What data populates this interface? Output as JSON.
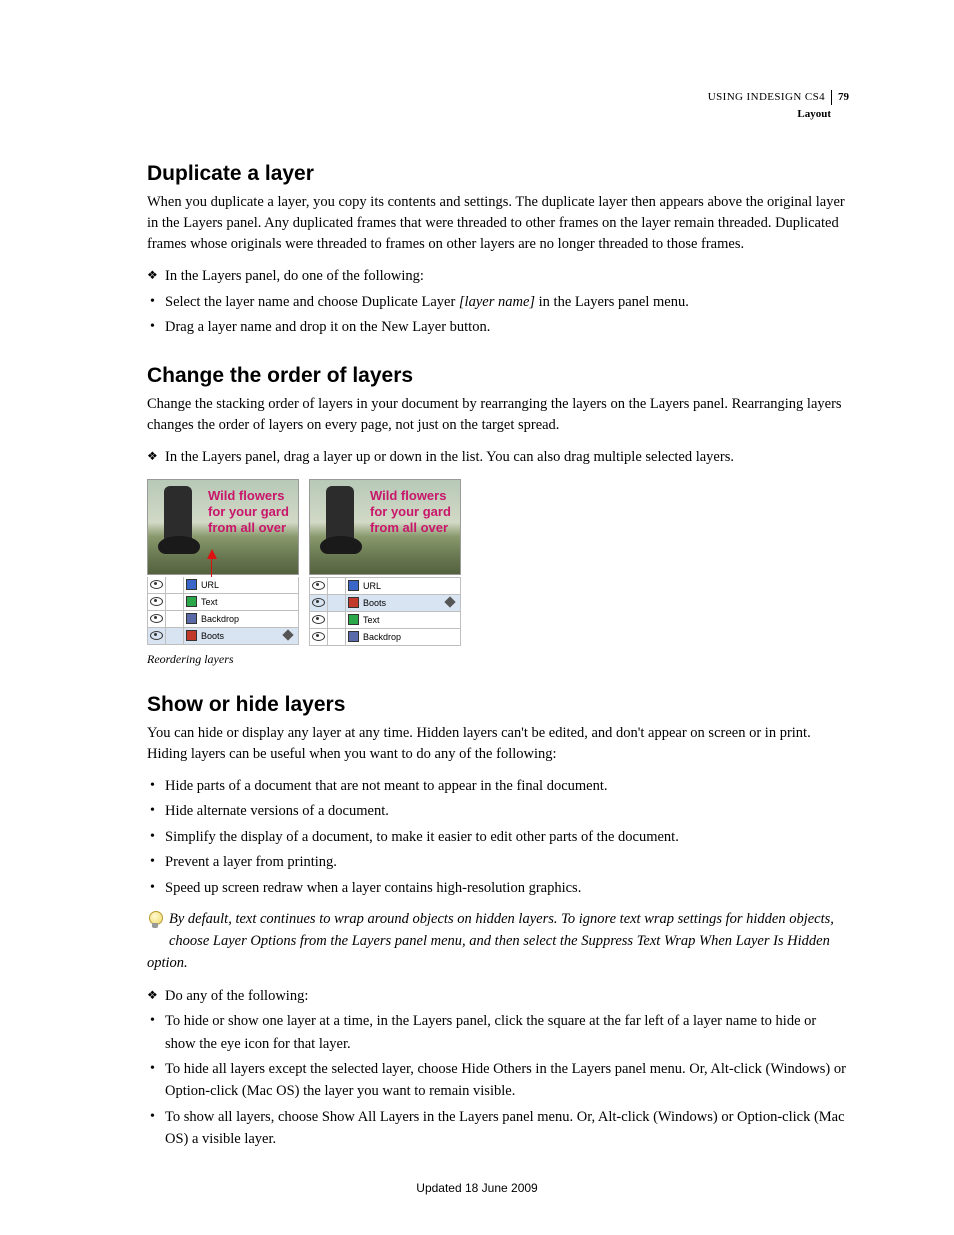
{
  "header": {
    "book": "USING INDESIGN CS4",
    "page_number": "79",
    "section": "Layout"
  },
  "section1": {
    "title": "Duplicate a layer",
    "intro": "When you duplicate a layer, you copy its contents and settings. The duplicate layer then appears above the original layer in the Layers panel. Any duplicated frames that were threaded to other frames on the layer remain threaded. Duplicated frames whose originals were threaded to frames on other layers are no longer threaded to those frames.",
    "lead": "In the Layers panel, do one of the following:",
    "opt1a": "Select the layer name and choose Duplicate Layer ",
    "opt1b": "[layer name]",
    "opt1c": " in the Layers panel menu.",
    "opt2": "Drag a layer name and drop it on the New Layer button."
  },
  "section2": {
    "title": "Change the order of layers",
    "intro": "Change the stacking order of layers in your document by rearranging the layers on the Layers panel. Rearranging layers changes the order of layers on every page, not just on the target spread.",
    "step": "In the Layers panel, drag a layer up or down in the list. You can also drag multiple selected layers.",
    "caption": "Reordering layers"
  },
  "figure": {
    "thumb_text_l1": "Wild flowers",
    "thumb_text_l2": "for your gard",
    "thumb_text_l3": "from all over",
    "left_layers": [
      {
        "name": "URL",
        "color": "#3a66c7",
        "sel": false
      },
      {
        "name": "Text",
        "color": "#2aa84a",
        "sel": false
      },
      {
        "name": "Backdrop",
        "color": "#5a6aa8",
        "sel": false
      },
      {
        "name": "Boots",
        "color": "#c0392b",
        "sel": true
      }
    ],
    "right_layers": [
      {
        "name": "URL",
        "color": "#3a66c7",
        "sel": false
      },
      {
        "name": "Boots",
        "color": "#c0392b",
        "sel": true
      },
      {
        "name": "Text",
        "color": "#2aa84a",
        "sel": false
      },
      {
        "name": "Backdrop",
        "color": "#5a6aa8",
        "sel": false
      }
    ]
  },
  "section3": {
    "title": "Show or hide layers",
    "intro": "You can hide or display any layer at any time. Hidden layers can't be edited, and don't appear on screen or in print. Hiding layers can be useful when you want to do any of the following:",
    "b1": "Hide parts of a document that are not meant to appear in the final document.",
    "b2": "Hide alternate versions of a document.",
    "b3": "Simplify the display of a document, to make it easier to edit other parts of the document.",
    "b4": "Prevent a layer from printing.",
    "b5": "Speed up screen redraw when a layer contains high-resolution graphics.",
    "tip": "By default, text continues to wrap around objects on hidden layers. To ignore text wrap settings for hidden objects, choose Layer Options from the Layers panel menu, and then select the Suppress Text Wrap When Layer Is Hidden option.",
    "lead2": "Do any of the following:",
    "a1": "To hide or show one layer at a time, in the Layers panel, click the square at the far left of a layer name to hide or show the eye icon for that layer.",
    "a2": "To hide all layers except the selected layer, choose Hide Others in the Layers panel menu. Or, Alt-click (Windows) or Option-click (Mac OS) the layer you want to remain visible.",
    "a3": "To show all layers, choose Show All Layers in the Layers panel menu. Or, Alt-click (Windows) or Option-click (Mac OS) a visible layer."
  },
  "footer": {
    "updated": "Updated 18 June 2009"
  }
}
